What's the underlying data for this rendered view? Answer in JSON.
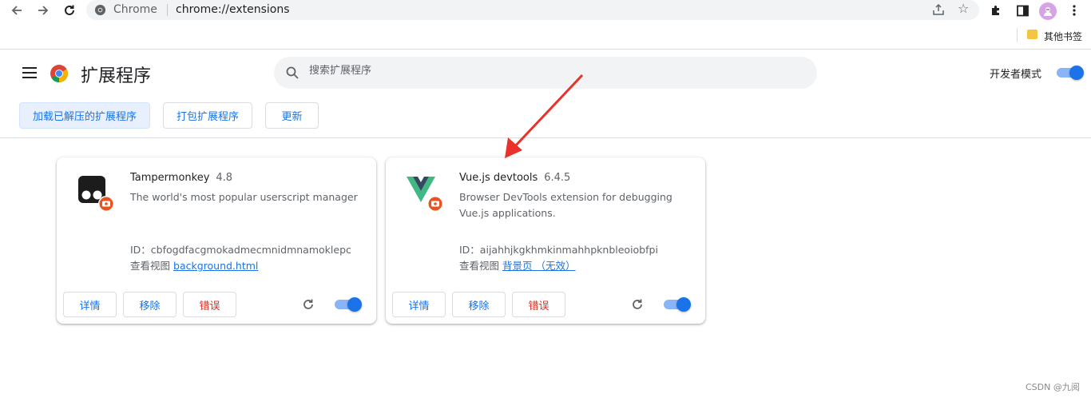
{
  "browser": {
    "site_label": "Chrome",
    "url": "chrome://extensions"
  },
  "bookmarks": {
    "folder_label": "其他书签"
  },
  "header": {
    "title": "扩展程序",
    "search_placeholder": "搜索扩展程序",
    "dev_mode_label": "开发者模式",
    "dev_mode_on": true,
    "buttons": {
      "load_unpacked": "加载已解压的扩展程序",
      "pack": "打包扩展程序",
      "update": "更新"
    }
  },
  "extensions": [
    {
      "name": "Tampermonkey",
      "version": "4.8",
      "description": "The world's most popular userscript manager",
      "id_line": "ID：cbfogdfacgmokadmecmnidmnamoklepc",
      "view_label": "查看视图",
      "view_link": "background.html",
      "details_label": "详情",
      "remove_label": "移除",
      "errors_label": "错误",
      "enabled": true
    },
    {
      "name": "Vue.js devtools",
      "version": "6.4.5",
      "description": "Browser DevTools extension for debugging Vue.js applications.",
      "id_line": "ID：aijahhjkgkhmkinmahhpknbleoiobfpi",
      "view_label": "查看视图",
      "view_link": "背景页 （无效）",
      "details_label": "详情",
      "remove_label": "移除",
      "errors_label": "错误",
      "enabled": true
    }
  ],
  "watermark": "CSDN @九阅",
  "colors": {
    "accent": "#1a73e8",
    "error": "#d93025",
    "annotation_arrow": "#e8322b"
  }
}
